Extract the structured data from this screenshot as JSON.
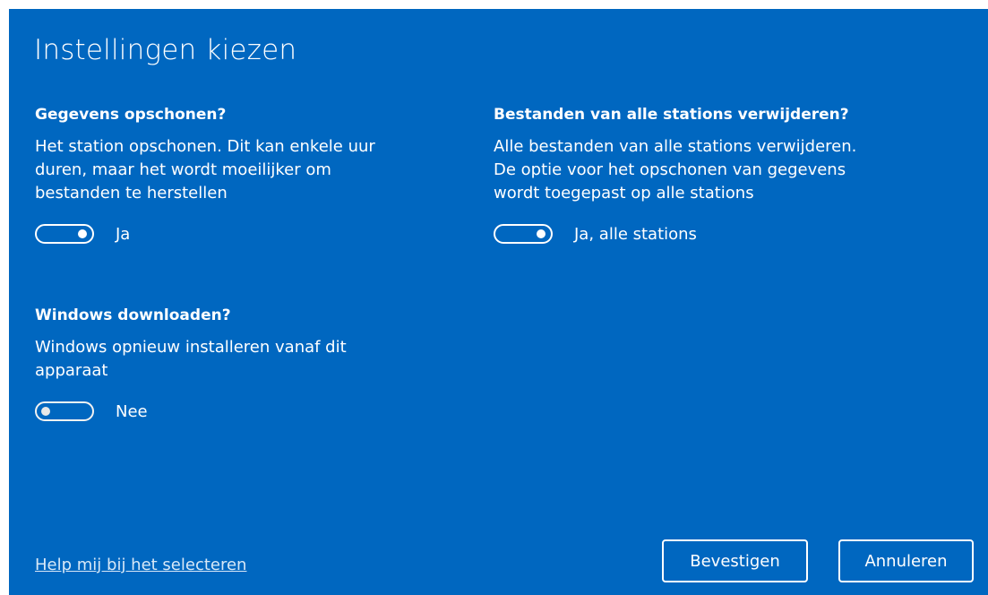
{
  "dialog": {
    "title": "Instellingen kiezen"
  },
  "settings": {
    "wipe": {
      "heading": "Gegevens opschonen?",
      "description": "Het station opschonen. Dit kan enkele uur\nduren, maar het wordt moeilijker om\nbestanden te herstellen",
      "state_label": "Ja",
      "enabled": true
    },
    "all_drives": {
      "heading": "Bestanden van alle stations verwijderen?",
      "description": "Alle bestanden van alle stations verwijderen.\nDe optie voor het opschonen van gegevens\nwordt toegepast op alle stations",
      "state_label": "Ja, alle stations",
      "enabled": true
    },
    "download": {
      "heading": "Windows downloaden?",
      "description": "Windows opnieuw installeren vanaf dit\napparaat",
      "state_label": "Nee",
      "enabled": false
    }
  },
  "footer": {
    "help_link": "Help mij bij het selecteren",
    "confirm_label": "Bevestigen",
    "cancel_label": "Annuleren"
  },
  "colors": {
    "background": "#0067c0",
    "text": "#ffffff"
  }
}
